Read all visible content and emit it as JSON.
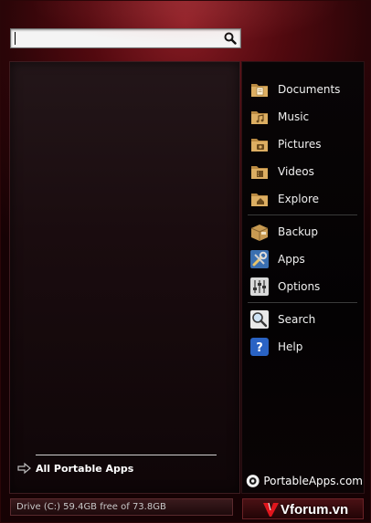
{
  "search": {
    "value": "",
    "placeholder": ""
  },
  "icons": {
    "search": "magnifier-icon",
    "all_apps_arrow": "arrow-right-icon",
    "folder": "folder-icon",
    "backup": "box-icon",
    "apps": "tools-icon",
    "options": "sliders-icon",
    "search_menu": "magnifier-icon",
    "help": "question-icon",
    "brand_logo": "portableapps-logo",
    "watermark_logo": "v-logo"
  },
  "menu": {
    "documents": "Documents",
    "music": "Music",
    "pictures": "Pictures",
    "videos": "Videos",
    "explore": "Explore",
    "backup": "Backup",
    "apps": "Apps",
    "options": "Options",
    "search": "Search",
    "help": "Help"
  },
  "all_apps_label": "All Portable Apps",
  "brand_label": "PortableApps.com",
  "status_text": "Drive (C:) 59.4GB free of 73.8GB",
  "watermark_text": "Vforum.vn",
  "colors": {
    "accent_red": "#8a1c24",
    "folder": "#d8a85a",
    "help_blue": "#2a63c4"
  }
}
